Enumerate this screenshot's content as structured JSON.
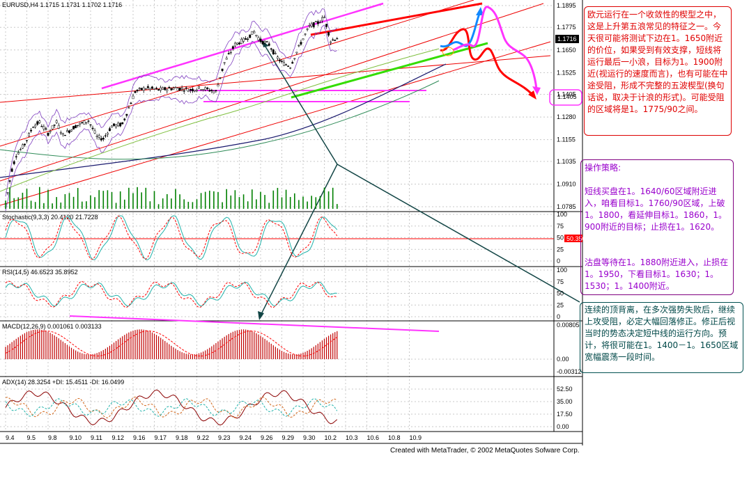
{
  "chart_data": [
    {
      "type": "candlestick",
      "title": "EURUSD,H4  1.1715 1.1731 1.1702 1.1716",
      "ylim": [
        1.0785,
        1.1895
      ],
      "y_ticks": [
        "1.1895",
        "1.1775",
        "1.1650",
        "1.1525",
        "1.1405",
        "1.1280",
        "1.1155",
        "1.1035",
        "1.0910",
        "1.0785"
      ],
      "current_price": "1.1716",
      "price_anchors": [
        {
          "x": 0.0,
          "y": 1.08
        },
        {
          "x": 0.3,
          "y": 1.099
        },
        {
          "x": 0.5,
          "y": 1.107
        },
        {
          "x": 0.9,
          "y": 1.113
        },
        {
          "x": 1.3,
          "y": 1.123
        },
        {
          "x": 1.6,
          "y": 1.125
        },
        {
          "x": 2.0,
          "y": 1.119
        },
        {
          "x": 2.4,
          "y": 1.125
        },
        {
          "x": 2.7,
          "y": 1.118
        },
        {
          "x": 3.3,
          "y": 1.123
        },
        {
          "x": 3.9,
          "y": 1.126
        },
        {
          "x": 4.3,
          "y": 1.117
        },
        {
          "x": 4.6,
          "y": 1.116
        },
        {
          "x": 5.0,
          "y": 1.123
        },
        {
          "x": 5.5,
          "y": 1.124
        },
        {
          "x": 6.1,
          "y": 1.142
        },
        {
          "x": 6.6,
          "y": 1.144
        },
        {
          "x": 7.2,
          "y": 1.143
        },
        {
          "x": 8.0,
          "y": 1.144
        },
        {
          "x": 8.7,
          "y": 1.143
        },
        {
          "x": 9.2,
          "y": 1.144
        },
        {
          "x": 9.9,
          "y": 1.142
        },
        {
          "x": 10.3,
          "y": 1.158
        },
        {
          "x": 10.8,
          "y": 1.168
        },
        {
          "x": 11.3,
          "y": 1.171
        },
        {
          "x": 11.7,
          "y": 1.175
        },
        {
          "x": 12.0,
          "y": 1.17
        },
        {
          "x": 12.4,
          "y": 1.168
        },
        {
          "x": 12.7,
          "y": 1.162
        },
        {
          "x": 13.0,
          "y": 1.158
        },
        {
          "x": 13.4,
          "y": 1.156
        },
        {
          "x": 13.9,
          "y": 1.169
        },
        {
          "x": 14.3,
          "y": 1.178
        },
        {
          "x": 14.7,
          "y": 1.18
        },
        {
          "x": 15.0,
          "y": 1.183
        },
        {
          "x": 15.3,
          "y": 1.17
        },
        {
          "x": 15.6,
          "y": 1.1716
        }
      ]
    },
    {
      "type": "line",
      "title": "Stochastic(9,3,3) 20.4120 21.7228",
      "ylim": [
        0,
        100
      ],
      "y_ticks": [
        "100",
        "75",
        "50",
        "25",
        "0"
      ],
      "level_label": "50.3506"
    },
    {
      "type": "line",
      "title": "RSI(14,5) 46.6523 35.8952",
      "ylim": [
        0,
        100
      ],
      "y_ticks": [
        "100",
        "75",
        "50",
        "25",
        "0"
      ]
    },
    {
      "type": "bar",
      "title": "MACD(12,26,9) 0.001061 0.003133",
      "y_ticks": [
        "0.00805",
        "0.00",
        "-0.00312"
      ]
    },
    {
      "type": "line",
      "title": "ADX(14) 28.3254 +DI: 15.4511 -DI: 16.0499",
      "ylim": [
        0,
        70
      ],
      "y_ticks": [
        "52.50",
        "35.00",
        "17.50",
        "0.00"
      ]
    }
  ],
  "x_ticks": [
    "9.4",
    "9.5",
    "9.8",
    "9.10",
    "9.11",
    "9.12",
    "9.16",
    "9.17",
    "9.18",
    "9.22",
    "9.23",
    "9.24",
    "9.26",
    "9.29",
    "9.30",
    "10.2",
    "10.3",
    "10.6",
    "10.8",
    "10.9"
  ],
  "current_level_box": "1.1405",
  "colors": {
    "up": "#000000",
    "down": "#000000",
    "grid": "#c8c8c8",
    "pink": "#ff33ff",
    "red": "#ff0000",
    "green": "#33dd00",
    "blue": "#1188ff",
    "teal": "#124545",
    "volume": "#008000",
    "stoch_main": "#20b2aa",
    "stoch_signal": "#ff0000"
  },
  "annotations": {
    "box1": "欧元运行在一个收敛性的楔型之中，这是上升第五浪常见的特征之一。今天很可能将测试下边在1。1650附近的价位，如果受到有效支撑，短线将运行最后一小浪，目标为1。1900附近(视运行的速度而言)，也有可能在中途受阻，形成不完整的五波楔型(换句话说，取决于计浪的形式)。可能受阻的区域将是1。1775/90之间。",
    "box2": "操作策略:\n\n短线买盘在1。1640/60区域附近进入，咱看目标1。1760/90区域，上破1。1800，看延伸目标1。1860，1。900附近的目标；止损在1。1620。\n\n\n沽盘等待在1。1880附近进入，止损在1。1950，下看目标1。1630；1。1530；1。1400附近。",
    "box3": "连续的顶背离，在多次强势失败后，继续上攻受阻，必定大幅回落修正。修正后视当时的势态决定短中线的运行方向。预计，将很可能在1。1400－1。1650区域宽幅震荡一段时间。"
  },
  "footer": "Created with MetaTrader, © 2002 MetaQuotes Sofware Corp."
}
